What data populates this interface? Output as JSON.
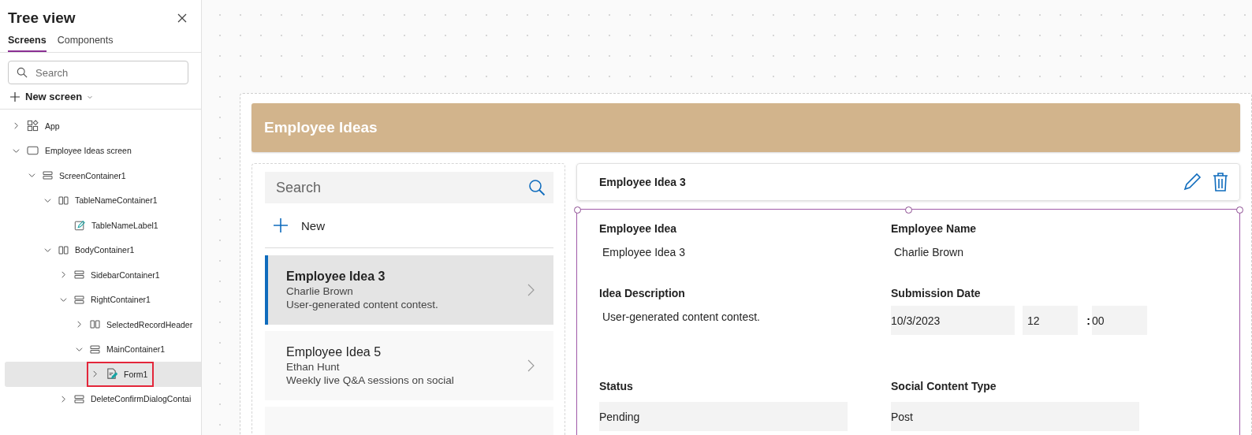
{
  "panel": {
    "title": "Tree view",
    "tabs": [
      {
        "label": "Screens",
        "selected": true
      },
      {
        "label": "Components",
        "selected": false
      }
    ],
    "search": {
      "placeholder": "Search"
    },
    "new_screen": "New screen",
    "tree": [
      {
        "label": "App",
        "kind": "app",
        "expanded": false,
        "selected": false
      },
      {
        "label": "Employee Ideas screen",
        "kind": "screen",
        "expanded": true,
        "selected": false,
        "children": [
          {
            "label": "ScreenContainer1",
            "kind": "vertical",
            "expanded": true,
            "selected": false,
            "children": [
              {
                "label": "TableNameContainer1",
                "kind": "horizontal",
                "expanded": true,
                "selected": false,
                "children": [
                  {
                    "label": "TableNameLabel1",
                    "kind": "label",
                    "selected": false
                  }
                ]
              },
              {
                "label": "BodyContainer1",
                "kind": "horizontal",
                "expanded": true,
                "selected": false,
                "children": [
                  {
                    "label": "SidebarContainer1",
                    "kind": "vertical",
                    "expanded": false,
                    "selected": false
                  },
                  {
                    "label": "RightContainer1",
                    "kind": "vertical",
                    "expanded": true,
                    "selected": false,
                    "children": [
                      {
                        "label": "SelectedRecordHeader",
                        "kind": "horizontal",
                        "expanded": false,
                        "selected": false
                      },
                      {
                        "label": "MainContainer1",
                        "kind": "vertical",
                        "expanded": true,
                        "selected": false,
                        "children": [
                          {
                            "label": "Form1",
                            "kind": "form",
                            "expanded": false,
                            "selected": true,
                            "highlighted": true
                          }
                        ]
                      }
                    ]
                  },
                  {
                    "label": "DeleteConfirmDialogContai",
                    "kind": "vertical",
                    "expanded": false,
                    "selected": false
                  }
                ]
              }
            ]
          }
        ]
      }
    ]
  },
  "app": {
    "header": "Employee Ideas",
    "gallery": {
      "search": {
        "placeholder": "Search"
      },
      "new": "New",
      "items": [
        {
          "title": "Employee Idea 3",
          "name": "Charlie Brown",
          "description": "User-generated content contest.",
          "selected": true
        },
        {
          "title": "Employee Idea 5",
          "name": "Ethan Hunt",
          "description": "Weekly live Q&A sessions on social",
          "selected": false
        },
        {
          "selected": false
        }
      ]
    },
    "record": {
      "title": "Employee Idea 3",
      "fields": [
        {
          "label": "Employee Idea",
          "kind": "text",
          "value": "Employee Idea 3"
        },
        {
          "label": "Employee Name",
          "kind": "text",
          "value": "Charlie Brown"
        },
        {
          "label": "Idea Description",
          "kind": "text",
          "value": "User-generated content contest."
        },
        {
          "label": "Submission Date",
          "kind": "datetime",
          "date": "10/3/2023",
          "hour": "12",
          "separator": ":",
          "minute": "00"
        },
        {
          "label": "Status",
          "kind": "input",
          "value": "Pending"
        },
        {
          "label": "Social Content Type",
          "kind": "input",
          "value": "Post"
        }
      ]
    }
  }
}
